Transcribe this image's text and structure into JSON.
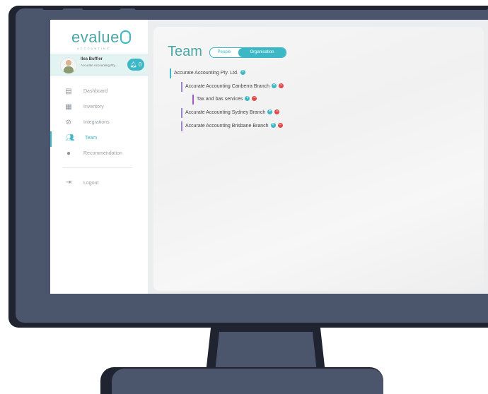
{
  "app": {
    "logo_text": "evalue",
    "logo_sub": "ACCOUNTING"
  },
  "user": {
    "name": "Ilea Buffier",
    "org": "Accurate Accounting Pty....",
    "notifications": "0"
  },
  "nav": {
    "items": [
      {
        "label": "Dashboard",
        "icon": "dashboard-icon"
      },
      {
        "label": "Inventory",
        "icon": "inventory-icon"
      },
      {
        "label": "Integrations",
        "icon": "integrations-icon"
      },
      {
        "label": "Team",
        "icon": "team-icon",
        "active": true
      },
      {
        "label": "Recommendation",
        "icon": "recommendation-icon"
      }
    ],
    "logout": "Logout"
  },
  "page": {
    "title": "Team",
    "toggle": {
      "people": "People",
      "organisation": "Organisation",
      "selected": "Organisation"
    }
  },
  "tree": [
    {
      "label": "Accurate Accounting Pty. Ltd.",
      "level": 0,
      "add": "+",
      "remove": ""
    },
    {
      "label": "Accurate Accounting Canberra Branch",
      "level": 1,
      "add": "+",
      "remove": "−"
    },
    {
      "label": "Tax and bas services",
      "level": 2,
      "add": "+",
      "remove": "−"
    },
    {
      "label": "Accurate Accounting Sydney Branch",
      "level": 1,
      "add": "+",
      "remove": "−"
    },
    {
      "label": "Accurate Accounting Brisbane Branch",
      "level": 1,
      "add": "+",
      "remove": "−"
    }
  ],
  "colors": {
    "accent": "#3bb7c6",
    "remove": "#e0484a",
    "bezel": "#1f2430",
    "frame": "#4b556b"
  }
}
